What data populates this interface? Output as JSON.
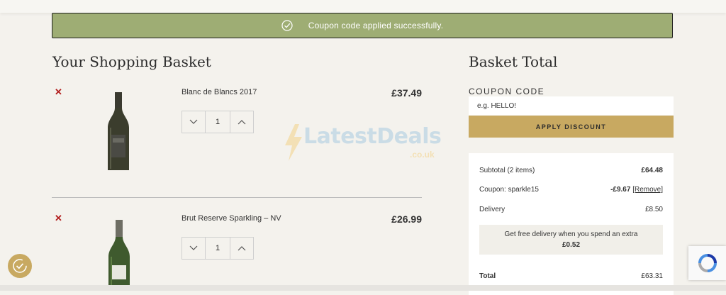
{
  "notice": {
    "message": "Coupon code applied successfully."
  },
  "basket": {
    "title": "Your Shopping Basket",
    "items": [
      {
        "name": "Blanc de Blancs 2017",
        "price": "£37.49",
        "quantity": "1"
      },
      {
        "name": "Brut Reserve Sparkling – NV",
        "price": "£26.99",
        "quantity": "1"
      }
    ]
  },
  "totals": {
    "title": "Basket Total",
    "coupon_label": "COUPON CODE",
    "coupon_placeholder": "e.g. HELLO!",
    "apply_label": "APPLY DISCOUNT",
    "subtotal_label": "Subtotal (2 items)",
    "subtotal_value": "£64.48",
    "coupon_line_label": "Coupon: sparkle15",
    "coupon_line_value": "-£9.67",
    "coupon_remove": "[Remove]",
    "delivery_label": "Delivery",
    "delivery_value": "£8.50",
    "free_delivery_text": "Get free delivery when you spend an extra",
    "free_delivery_amount": "£0.52",
    "total_label": "Total",
    "total_value": "£63.31"
  },
  "watermark": {
    "main": "LatestDeals",
    "sub": ".co.uk"
  },
  "colors": {
    "success": "#9ead74",
    "gold": "#c8a961",
    "remove": "#b21e1e",
    "background": "#f4f2ed"
  }
}
